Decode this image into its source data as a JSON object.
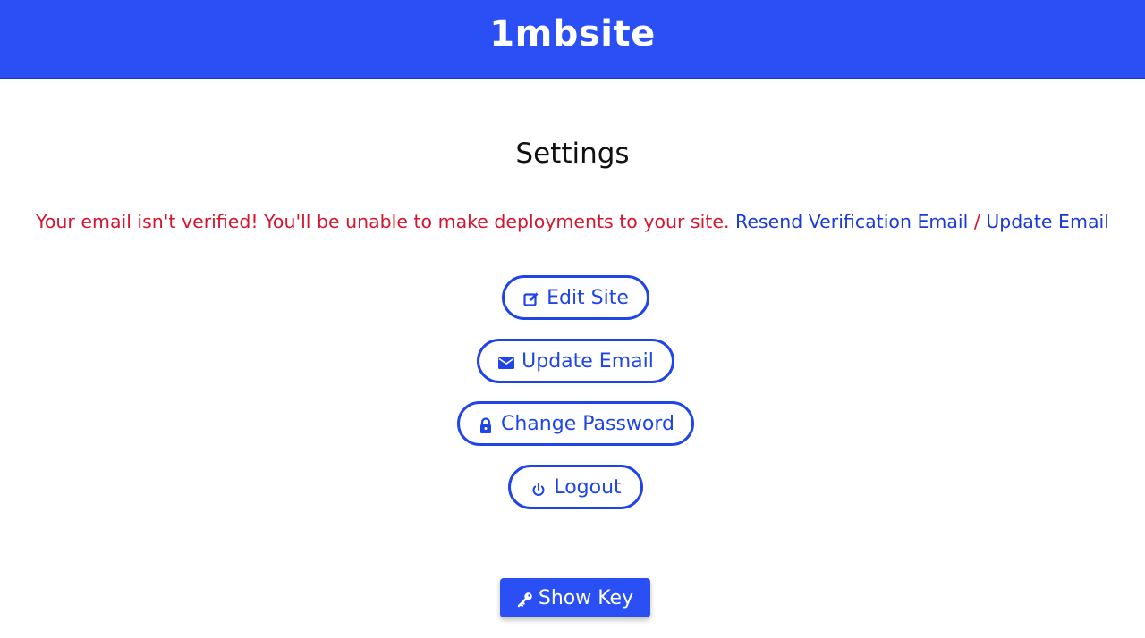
{
  "header": {
    "brand": "1mbsite",
    "color": "#2a4ff5"
  },
  "page": {
    "title": "Settings"
  },
  "notice": {
    "message": "Your email isn't verified! You'll be unable to make deployments to your site. ",
    "resend_link": "Resend Verification Email",
    "separator": " / ",
    "update_link": "Update Email",
    "message_color": "#d4152f",
    "link_color": "#1b3ad6"
  },
  "actions": {
    "edit_site": {
      "label": "Edit Site",
      "icon": "edit-icon"
    },
    "update_email": {
      "label": "Update Email",
      "icon": "envelope-icon"
    },
    "change_password": {
      "label": "Change Password",
      "icon": "lock-icon"
    },
    "logout": {
      "label": "Logout",
      "icon": "power-icon"
    }
  },
  "key_button": {
    "label": "Show Key",
    "icon": "key-icon"
  }
}
